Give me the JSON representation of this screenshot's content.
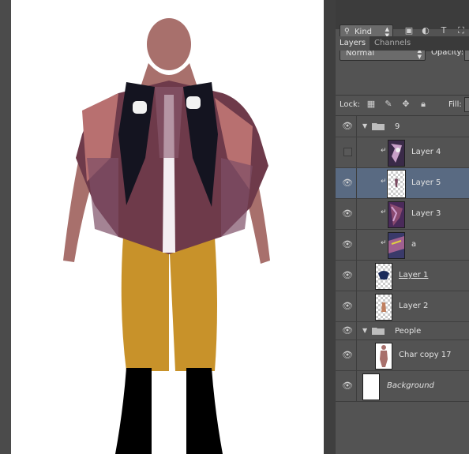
{
  "panel": {
    "tabs": [
      {
        "label": "Layers",
        "active": true
      },
      {
        "label": "Channels",
        "active": false
      }
    ],
    "filter": {
      "kind_label": "Kind",
      "icons": [
        "image-filter-icon",
        "adjustment-filter-icon",
        "type-filter-icon",
        "shape-filter-icon"
      ]
    },
    "blend_mode": "Normal",
    "opacity_label": "Opacity:",
    "lock_label": "Lock:",
    "fill_label": "Fill:",
    "lock_icons": [
      "lock-transparent-pixels-icon",
      "lock-image-pixels-icon",
      "lock-position-icon",
      "lock-all-icon"
    ]
  },
  "layers": [
    {
      "name": "9",
      "kind": "group",
      "visible": true,
      "expanded": true
    },
    {
      "name": "Layer 4",
      "kind": "layer",
      "visible": false,
      "clipped": true
    },
    {
      "name": "Layer 5",
      "kind": "layer",
      "visible": true,
      "clipped": true,
      "selected": true
    },
    {
      "name": "Layer 3",
      "kind": "layer",
      "visible": true,
      "clipped": true
    },
    {
      "name": "a",
      "kind": "layer",
      "visible": true,
      "clipped": true
    },
    {
      "name": "Layer 1",
      "kind": "layer",
      "visible": true,
      "underlined": true
    },
    {
      "name": "Layer 2",
      "kind": "layer",
      "visible": true
    },
    {
      "name": "People",
      "kind": "group",
      "visible": true,
      "expanded": true
    },
    {
      "name": "Char copy 17",
      "kind": "layer",
      "visible": true
    },
    {
      "name": "Background",
      "kind": "background",
      "visible": true,
      "italic": true
    }
  ],
  "colors": {
    "panel_bg": "#535353",
    "selected_layer": "#596a82",
    "canvas_bg": "#ffffff",
    "skin": "#a8706c",
    "pants": "#c8922a",
    "cape": "#6e3a4a"
  }
}
